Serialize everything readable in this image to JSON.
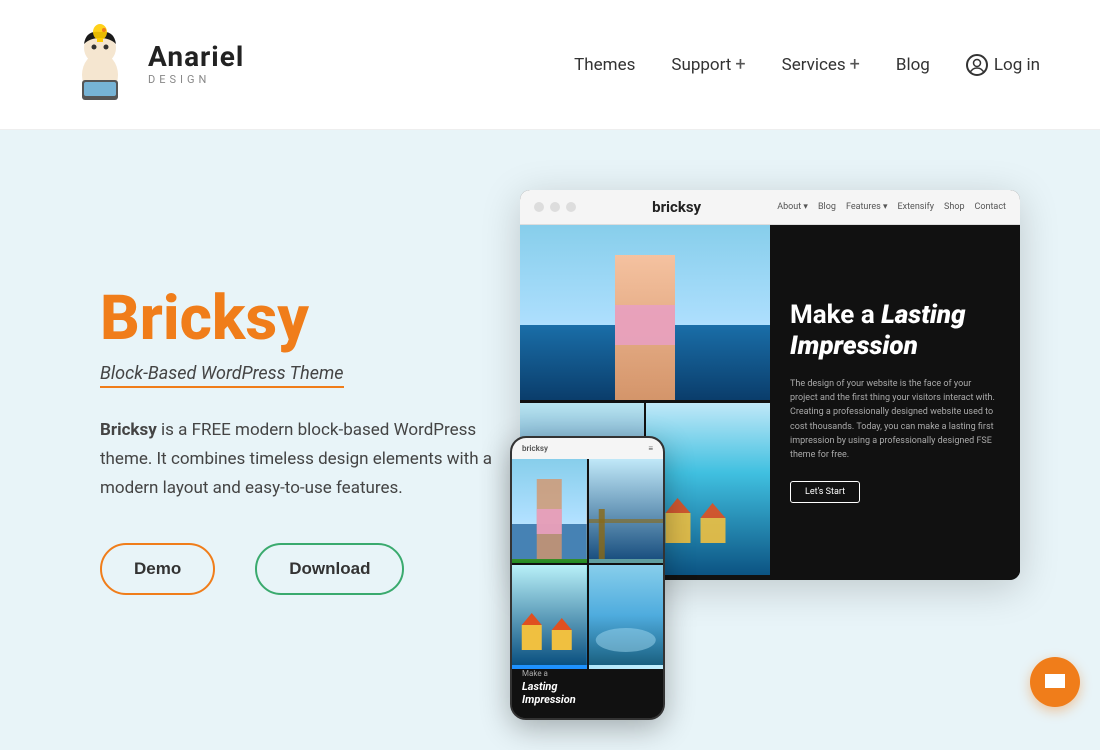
{
  "header": {
    "logo_text": "Anariel",
    "logo_subtext": "DESIGN",
    "nav_items": [
      {
        "label": "Themes",
        "has_plus": false
      },
      {
        "label": "Support",
        "has_plus": true
      },
      {
        "label": "Services",
        "has_plus": true
      },
      {
        "label": "Blog",
        "has_plus": false
      }
    ],
    "login_label": "Log in"
  },
  "hero": {
    "title": "Bricksy",
    "subtitle": "Block-Based WordPress Theme",
    "description_part1": "Bricksy",
    "description_part2": " is a FREE modern block-based WordPress theme. It combines timeless design elements with a modern layout and easy-to-use features.",
    "btn_demo": "Demo",
    "btn_download": "Download"
  },
  "browser_mockup": {
    "logo": "bricksy",
    "nav_items": [
      "About ▾",
      "Blog",
      "Features ▾",
      "Extensify",
      "Shop",
      "Contact"
    ],
    "tagline_line1": "Make a",
    "tagline_line2": "Lasting",
    "tagline_line3": "Impression",
    "body_text": "The design of your website is the face of your project and the first thing your visitors interact with. Creating a professionally designed website used to cost thousands. Today, you can make a lasting first impression by using a professionally designed FSE theme for free.",
    "cta": "Let's Start"
  },
  "mobile_mockup": {
    "bar_label": "bricksy",
    "caption_small": "Make a",
    "caption_big_1": "Lasting",
    "caption_big_2": "Impression"
  },
  "chat": {
    "icon": "💬"
  }
}
